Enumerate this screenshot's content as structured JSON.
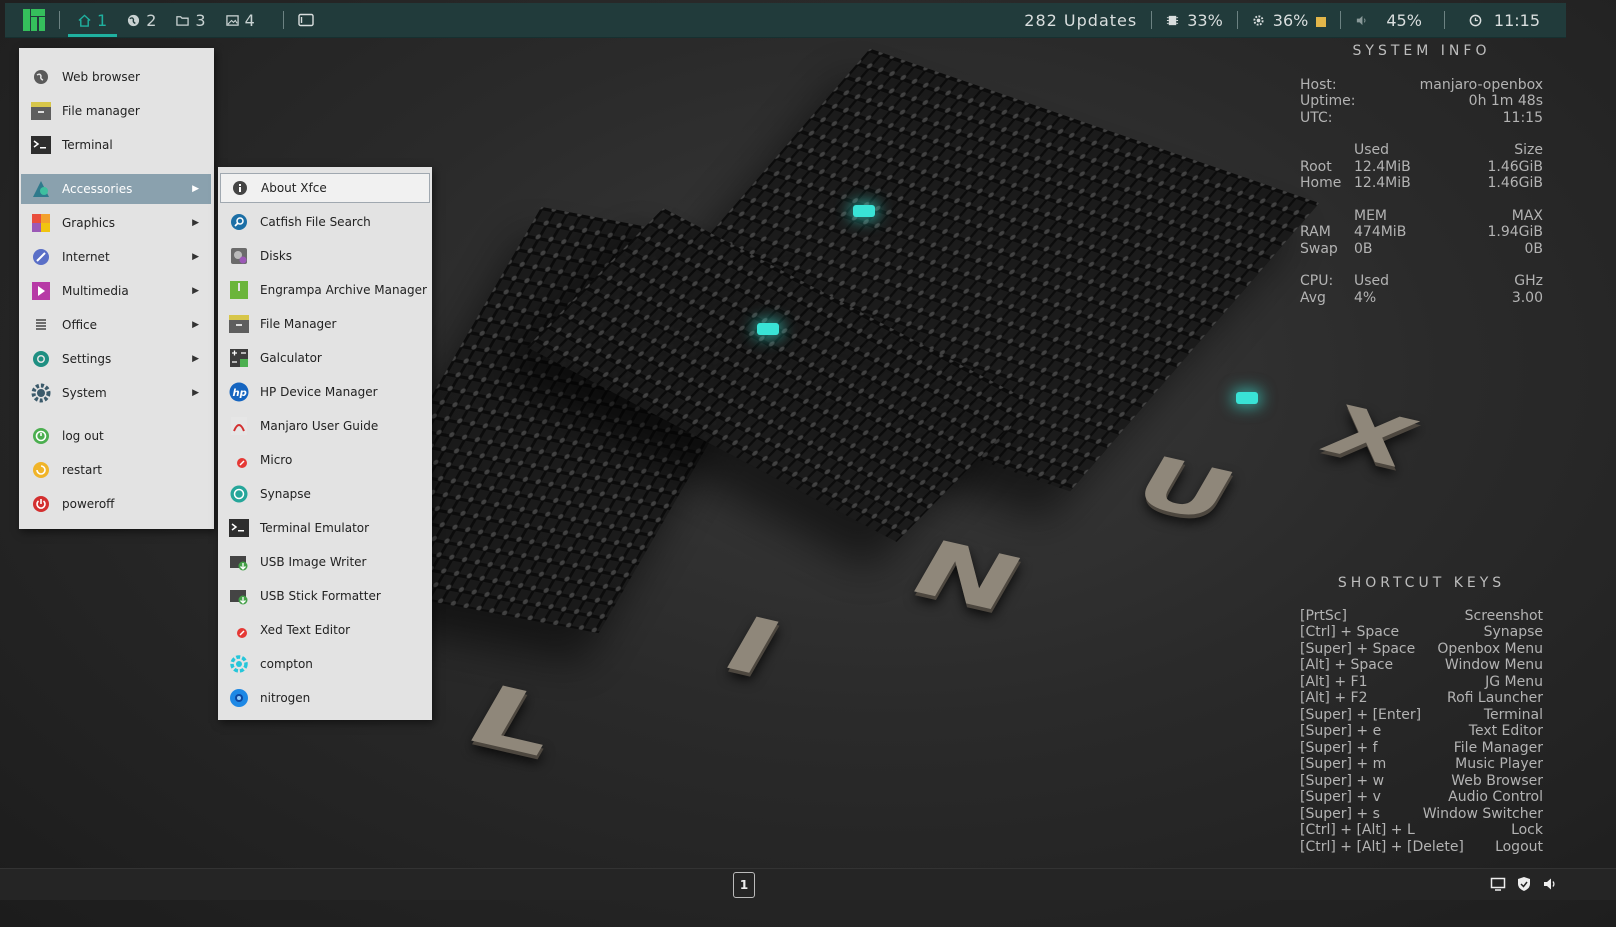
{
  "top_panel": {
    "workspaces": [
      {
        "num": "1",
        "icon": "home-icon"
      },
      {
        "num": "2",
        "icon": "globe-icon"
      },
      {
        "num": "3",
        "icon": "folder-icon"
      },
      {
        "num": "4",
        "icon": "image-icon"
      }
    ],
    "updates": "282 Updates",
    "cpu": "33%",
    "temp": "36%",
    "volume": "45%",
    "clock": "11:15"
  },
  "menu": {
    "items": [
      {
        "label": "Web browser",
        "icon": "globe-icon"
      },
      {
        "label": "File manager",
        "icon": "file-manager-icon"
      },
      {
        "label": "Terminal",
        "icon": "terminal-icon"
      },
      {
        "label": "Accessories",
        "icon": "accessories-icon"
      },
      {
        "label": "Graphics",
        "icon": "graphics-icon"
      },
      {
        "label": "Internet",
        "icon": "internet-icon"
      },
      {
        "label": "Multimedia",
        "icon": "multimedia-icon"
      },
      {
        "label": "Office",
        "icon": "office-icon"
      },
      {
        "label": "Settings",
        "icon": "settings-icon"
      },
      {
        "label": "System",
        "icon": "system-icon"
      },
      {
        "label": "log out",
        "icon": "logout-icon"
      },
      {
        "label": "restart",
        "icon": "restart-icon"
      },
      {
        "label": "poweroff",
        "icon": "poweroff-icon"
      }
    ]
  },
  "submenu": {
    "items": [
      {
        "label": "About Xfce",
        "icon": "info-icon"
      },
      {
        "label": "Catfish File Search",
        "icon": "search-icon"
      },
      {
        "label": "Disks",
        "icon": "disks-icon"
      },
      {
        "label": "Engrampa Archive Manager",
        "icon": "archive-icon"
      },
      {
        "label": "File Manager",
        "icon": "file-manager-icon"
      },
      {
        "label": "Galculator",
        "icon": "calculator-icon"
      },
      {
        "label": "HP Device Manager",
        "icon": "hp-icon"
      },
      {
        "label": "Manjaro User Guide",
        "icon": "pdf-icon"
      },
      {
        "label": "Micro",
        "icon": "text-editor-icon"
      },
      {
        "label": "Synapse",
        "icon": "synapse-icon"
      },
      {
        "label": "Terminal Emulator",
        "icon": "terminal-icon"
      },
      {
        "label": "USB Image Writer",
        "icon": "usb-writer-icon"
      },
      {
        "label": "USB Stick Formatter",
        "icon": "usb-formatter-icon"
      },
      {
        "label": "Xed Text Editor",
        "icon": "text-editor-icon"
      },
      {
        "label": "compton",
        "icon": "compton-icon"
      },
      {
        "label": "nitrogen",
        "icon": "nitrogen-icon"
      }
    ]
  },
  "conky": {
    "sys_title": "SYSTEM INFO",
    "host_label": "Host:",
    "host_value": "manjaro-openbox",
    "uptime_label": "Uptime:",
    "uptime_value": "0h 1m 48s",
    "utc_label": "UTC:",
    "utc_value": "11:15",
    "disk_head": {
      "used": "Used",
      "size": "Size"
    },
    "disks": [
      {
        "name": "Root",
        "used": "12.4MiB",
        "size": "1.46GiB"
      },
      {
        "name": "Home",
        "used": "12.4MiB",
        "size": "1.46GiB"
      }
    ],
    "mem_head": {
      "mem": "MEM",
      "max": "MAX"
    },
    "mem": [
      {
        "name": "RAM",
        "used": "474MiB",
        "max": "1.94GiB"
      },
      {
        "name": "Swap",
        "used": "0B",
        "max": "0B"
      }
    ],
    "cpu_head": {
      "name": "CPU:",
      "used": "Used",
      "ghz": "GHz"
    },
    "cpu_row": {
      "name": "Avg",
      "used": "4%",
      "ghz": "3.00"
    },
    "keys_title": "SHORTCUT KEYS",
    "shortcuts": [
      {
        "key": "[PrtSc]",
        "action": "Screenshot"
      },
      {
        "key": "[Ctrl] + Space",
        "action": "Synapse"
      },
      {
        "key": "[Super] + Space",
        "action": "Openbox Menu"
      },
      {
        "key": "[Alt] + Space",
        "action": "Window Menu"
      },
      {
        "key": "[Alt] + F1",
        "action": "JG Menu"
      },
      {
        "key": "[Alt] + F2",
        "action": "Rofi Launcher"
      },
      {
        "key": "[Super] + [Enter]",
        "action": "Terminal"
      },
      {
        "key": "[Super] + e",
        "action": "Text Editor"
      },
      {
        "key": "[Super] + f",
        "action": "File Manager"
      },
      {
        "key": "[Super] + m",
        "action": "Music Player"
      },
      {
        "key": "[Super] + w",
        "action": "Web Browser"
      },
      {
        "key": "[Super] + v",
        "action": "Audio Control"
      },
      {
        "key": "[Super] + s",
        "action": "Window Switcher"
      },
      {
        "key": "[Ctrl] + [Alt] + L",
        "action": "Lock"
      },
      {
        "key": "[Ctrl] + [Alt] + [Delete]",
        "action": "Logout"
      }
    ]
  },
  "wallpaper": {
    "letters": [
      "L",
      "I",
      "N",
      "U",
      "X"
    ]
  },
  "bottom_panel": {
    "pager": "1"
  },
  "colors": {
    "panel": "#213b3b",
    "accent": "#1fb1a0",
    "menu_bg": "#e3e3e3",
    "menu_sel": "#8aa1ae"
  }
}
